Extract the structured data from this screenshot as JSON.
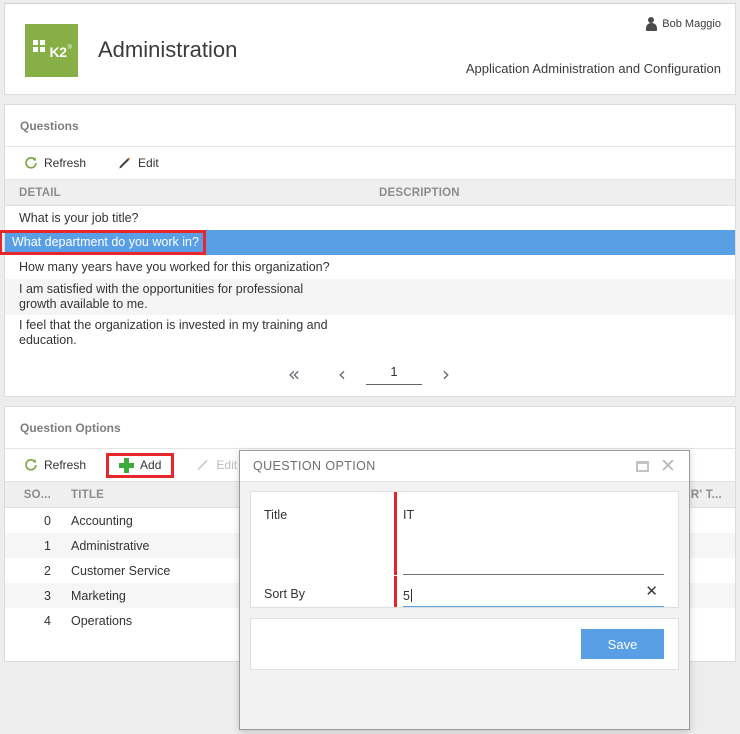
{
  "header": {
    "logo_text": "K2",
    "logo_tm": "®",
    "app_title": "Administration",
    "user_name": "Bob Maggio",
    "subtitle": "Application Administration and Configuration",
    "brand_color": "#86b046"
  },
  "questions_panel": {
    "title": "Questions",
    "toolbar": {
      "refresh_label": "Refresh",
      "edit_label": "Edit"
    },
    "columns": [
      "DETAIL",
      "DESCRIPTION"
    ],
    "rows": [
      {
        "detail": "What is your job title?",
        "description": "",
        "selected": false
      },
      {
        "detail": "What department do you work in?",
        "description": "",
        "selected": true
      },
      {
        "detail": "How many years have you worked for this organization?",
        "description": "",
        "selected": false
      },
      {
        "detail": "I am satisfied with the opportunities for professional growth available to me.",
        "description": "",
        "selected": false
      },
      {
        "detail": "I feel that the organization is invested in my training and education.",
        "description": "",
        "selected": false
      }
    ],
    "pager": {
      "first": "«",
      "prev": "‹",
      "page": "1",
      "next": "›"
    }
  },
  "options_panel": {
    "title": "Question Options",
    "toolbar": {
      "refresh_label": "Refresh",
      "add_label": "Add",
      "edit_label": "Edit"
    },
    "columns": [
      "SO...",
      "TITLE",
      "",
      "ER' T..."
    ],
    "rows": [
      {
        "sort": "0",
        "title": "Accounting"
      },
      {
        "sort": "1",
        "title": "Administrative"
      },
      {
        "sort": "2",
        "title": "Customer Service"
      },
      {
        "sort": "3",
        "title": "Marketing"
      },
      {
        "sort": "4",
        "title": "Operations"
      }
    ]
  },
  "modal": {
    "title": "QUESTION OPTION",
    "maximize_label": "maximize",
    "close_label": "close",
    "fields": {
      "title_label": "Title",
      "title_value": "IT",
      "sort_label": "Sort By",
      "sort_value": "5"
    },
    "save_label": "Save",
    "accent_color": "#589fe6",
    "required_color": "#e8212b"
  },
  "highlight_color": "#e8272c"
}
